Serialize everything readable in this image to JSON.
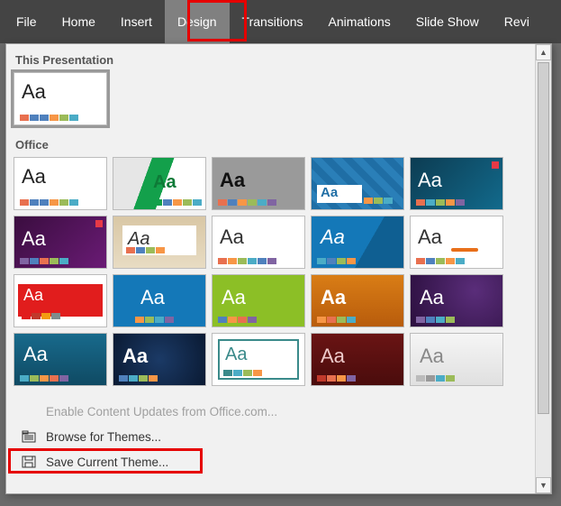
{
  "ribbon": {
    "tabs": [
      "File",
      "Home",
      "Insert",
      "Design",
      "Transitions",
      "Animations",
      "Slide Show",
      "Revi"
    ],
    "active_index": 3
  },
  "dropdown": {
    "section1_title": "This Presentation",
    "section2_title": "Office",
    "aa_label": "Aa",
    "footer": {
      "enable_updates": "Enable Content Updates from Office.com...",
      "browse": "Browse for Themes...",
      "save": "Save Current Theme..."
    }
  }
}
